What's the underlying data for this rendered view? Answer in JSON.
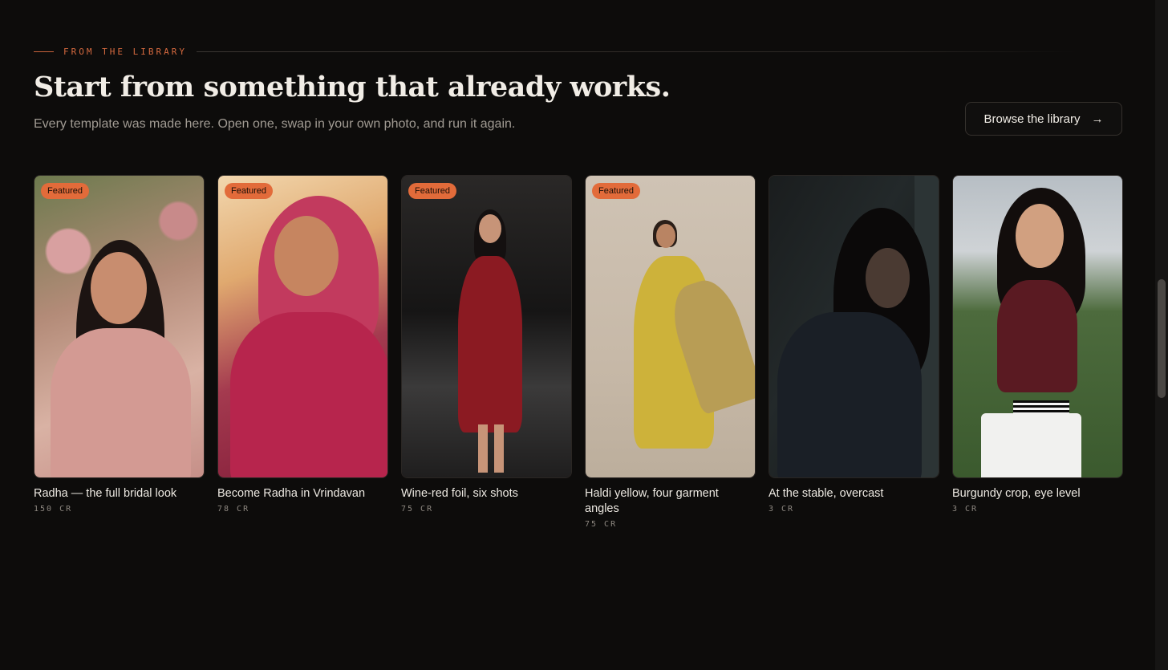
{
  "section": {
    "eyebrow": "FROM THE LIBRARY",
    "title": "Start from something that already works.",
    "subtitle": "Every template was made here. Open one, swap in your own photo, and run it again.",
    "browse_button": {
      "label": "Browse the library",
      "icon": "arrow-right-icon"
    }
  },
  "accent_color": "#e26b3a",
  "cards": [
    {
      "badge": "Featured",
      "name": "Radha — the full bridal look",
      "price": "150 CR"
    },
    {
      "badge": "Featured",
      "name": "Become Radha in Vrindavan",
      "price": "78 CR"
    },
    {
      "badge": "Featured",
      "name": "Wine-red foil, six shots",
      "price": "75 CR"
    },
    {
      "badge": "Featured",
      "name": "Haldi yellow, four garment angles",
      "price": "75 CR"
    },
    {
      "badge": "",
      "name": "At the stable, overcast",
      "price": "3 CR"
    },
    {
      "badge": "",
      "name": "Burgundy crop, eye level",
      "price": "3 CR"
    }
  ]
}
